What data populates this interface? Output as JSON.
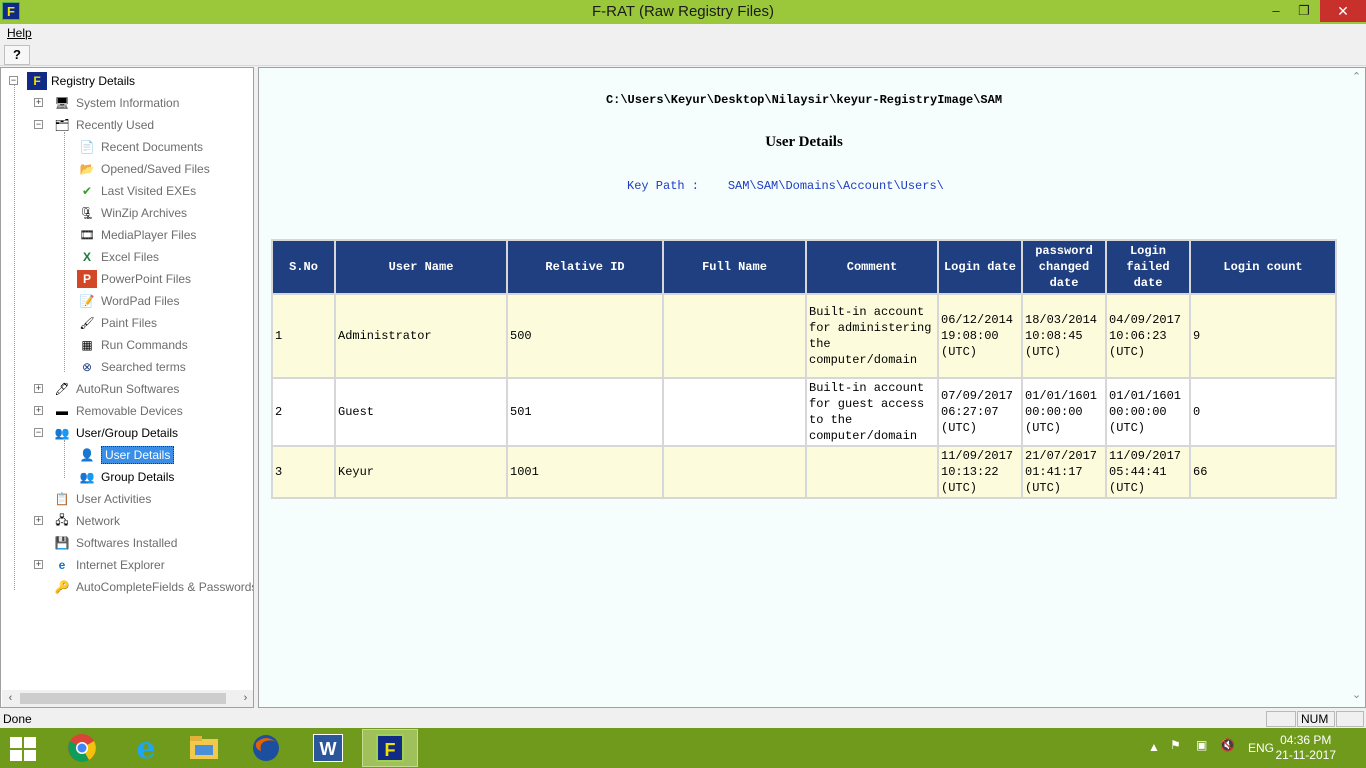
{
  "window": {
    "app_icon": "F",
    "title": "F-RAT (Raw Registry Files)",
    "controls": {
      "minimize": "–",
      "maximize": "❐",
      "close": "✕"
    }
  },
  "menu": {
    "help": "Help"
  },
  "toolbar": {
    "help_icon": "?"
  },
  "tree": {
    "root": "Registry Details",
    "items": [
      {
        "label": "System Information",
        "icon": "computer-icon"
      },
      {
        "label": "Recently Used",
        "icon": "history-icon"
      },
      {
        "label": "Recent Documents",
        "icon": "document-icon"
      },
      {
        "label": "Opened/Saved Files",
        "icon": "folder-icon"
      },
      {
        "label": "Last Visited EXEs",
        "icon": "check-icon"
      },
      {
        "label": "WinZip Archives",
        "icon": "zip-icon"
      },
      {
        "label": "MediaPlayer Files",
        "icon": "media-icon"
      },
      {
        "label": "Excel Files",
        "icon": "excel-icon"
      },
      {
        "label": "PowerPoint Files",
        "icon": "powerpoint-icon"
      },
      {
        "label": "WordPad Files",
        "icon": "wordpad-icon"
      },
      {
        "label": "Paint Files",
        "icon": "paint-icon"
      },
      {
        "label": "Run Commands",
        "icon": "run-icon"
      },
      {
        "label": "Searched terms",
        "icon": "binoculars-icon"
      },
      {
        "label": "AutoRun Softwares",
        "icon": "autorun-icon"
      },
      {
        "label": "Removable Devices",
        "icon": "usb-drive-icon"
      },
      {
        "label": "User/Group Details",
        "icon": "users-icon"
      },
      {
        "label": "User Details",
        "icon": "user-icon"
      },
      {
        "label": "Group Details",
        "icon": "group-icon"
      },
      {
        "label": "User Activities",
        "icon": "activity-icon"
      },
      {
        "label": "Network",
        "icon": "network-icon"
      },
      {
        "label": "Softwares Installed",
        "icon": "software-icon"
      },
      {
        "label": "Internet Explorer",
        "icon": "ie-icon"
      },
      {
        "label": "AutoCompleteFields & Passwords",
        "icon": "key-icon"
      }
    ]
  },
  "content": {
    "file_path": "C:\\Users\\Keyur\\Desktop\\Nilaysir\\keyur-RegistryImage\\SAM",
    "heading": "User Details",
    "key_path_label": "Key Path :",
    "key_path_value": "SAM\\SAM\\Domains\\Account\\Users\\",
    "columns": [
      "S.No",
      "User Name",
      "Relative ID",
      "Full Name",
      "Comment",
      "Login date",
      "password changed date",
      "Login failed date",
      "Login count"
    ],
    "rows": [
      {
        "sno": "1",
        "user_name": "Administrator",
        "relative_id": "500",
        "full_name": "",
        "comment": "Built-in account for administering the computer/domain",
        "login_date": "06/12/2014 19:08:00 (UTC)",
        "password_changed": "18/03/2014 10:08:45 (UTC)",
        "login_failed": "04/09/2017 10:06:23 (UTC)",
        "login_count": "9"
      },
      {
        "sno": "2",
        "user_name": "Guest",
        "relative_id": "501",
        "full_name": "",
        "comment": "Built-in account for guest access to the computer/domain",
        "login_date": "07/09/2017 06:27:07 (UTC)",
        "password_changed": "01/01/1601 00:00:00 (UTC)",
        "login_failed": "01/01/1601 00:00:00 (UTC)",
        "login_count": "0"
      },
      {
        "sno": "3",
        "user_name": "Keyur",
        "relative_id": "1001",
        "full_name": "",
        "comment": "",
        "login_date": "11/09/2017 10:13:22 (UTC)",
        "password_changed": "21/07/2017 01:41:17 (UTC)",
        "login_failed": "11/09/2017 05:44:41 (UTC)",
        "login_count": "66"
      }
    ]
  },
  "statusbar": {
    "text": "Done",
    "num": "NUM"
  },
  "taskbar": {
    "apps": [
      "chrome-icon",
      "internet-explorer-icon",
      "file-explorer-icon",
      "firefox-icon",
      "word-icon",
      "frat-icon"
    ],
    "language": "ENG",
    "time": "04:36 PM",
    "date": "21-11-2017"
  },
  "colors": {
    "titlebar": "#9bc83a",
    "table_header": "#1f3f80",
    "row_odd": "#fcfcdc",
    "selected": "#3a8ee6",
    "taskbar": "#6f9a1c"
  }
}
